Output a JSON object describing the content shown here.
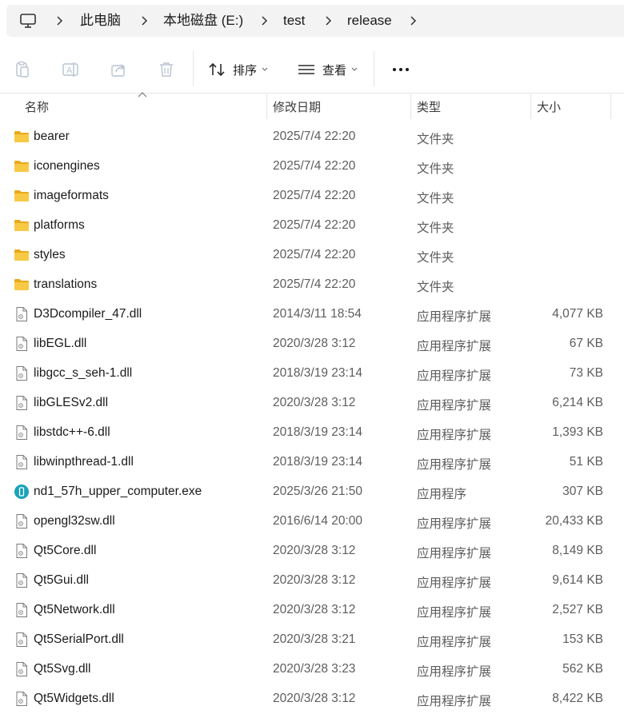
{
  "breadcrumb": [
    "此电脑",
    "本地磁盘 (E:)",
    "test",
    "release"
  ],
  "toolbar": {
    "sort_label": "排序",
    "view_label": "查看"
  },
  "columns": {
    "name": "名称",
    "date": "修改日期",
    "type": "类型",
    "size": "大小"
  },
  "files": [
    {
      "icon": "folder",
      "name": "bearer",
      "date": "2025/7/4 22:20",
      "type": "文件夹",
      "size": ""
    },
    {
      "icon": "folder",
      "name": "iconengines",
      "date": "2025/7/4 22:20",
      "type": "文件夹",
      "size": ""
    },
    {
      "icon": "folder",
      "name": "imageformats",
      "date": "2025/7/4 22:20",
      "type": "文件夹",
      "size": ""
    },
    {
      "icon": "folder",
      "name": "platforms",
      "date": "2025/7/4 22:20",
      "type": "文件夹",
      "size": ""
    },
    {
      "icon": "folder",
      "name": "styles",
      "date": "2025/7/4 22:20",
      "type": "文件夹",
      "size": ""
    },
    {
      "icon": "folder",
      "name": "translations",
      "date": "2025/7/4 22:20",
      "type": "文件夹",
      "size": ""
    },
    {
      "icon": "dll",
      "name": "D3Dcompiler_47.dll",
      "date": "2014/3/11 18:54",
      "type": "应用程序扩展",
      "size": "4,077 KB"
    },
    {
      "icon": "dll",
      "name": "libEGL.dll",
      "date": "2020/3/28 3:12",
      "type": "应用程序扩展",
      "size": "67 KB"
    },
    {
      "icon": "dll",
      "name": "libgcc_s_seh-1.dll",
      "date": "2018/3/19 23:14",
      "type": "应用程序扩展",
      "size": "73 KB"
    },
    {
      "icon": "dll",
      "name": "libGLESv2.dll",
      "date": "2020/3/28 3:12",
      "type": "应用程序扩展",
      "size": "6,214 KB"
    },
    {
      "icon": "dll",
      "name": "libstdc++-6.dll",
      "date": "2018/3/19 23:14",
      "type": "应用程序扩展",
      "size": "1,393 KB"
    },
    {
      "icon": "dll",
      "name": "libwinpthread-1.dll",
      "date": "2018/3/19 23:14",
      "type": "应用程序扩展",
      "size": "51 KB"
    },
    {
      "icon": "exe",
      "name": "nd1_57h_upper_computer.exe",
      "date": "2025/3/26 21:50",
      "type": "应用程序",
      "size": "307 KB"
    },
    {
      "icon": "dll",
      "name": "opengl32sw.dll",
      "date": "2016/6/14 20:00",
      "type": "应用程序扩展",
      "size": "20,433 KB"
    },
    {
      "icon": "dll",
      "name": "Qt5Core.dll",
      "date": "2020/3/28 3:12",
      "type": "应用程序扩展",
      "size": "8,149 KB"
    },
    {
      "icon": "dll",
      "name": "Qt5Gui.dll",
      "date": "2020/3/28 3:12",
      "type": "应用程序扩展",
      "size": "9,614 KB"
    },
    {
      "icon": "dll",
      "name": "Qt5Network.dll",
      "date": "2020/3/28 3:12",
      "type": "应用程序扩展",
      "size": "2,527 KB"
    },
    {
      "icon": "dll",
      "name": "Qt5SerialPort.dll",
      "date": "2020/3/28 3:21",
      "type": "应用程序扩展",
      "size": "153 KB"
    },
    {
      "icon": "dll",
      "name": "Qt5Svg.dll",
      "date": "2020/3/28 3:23",
      "type": "应用程序扩展",
      "size": "562 KB"
    },
    {
      "icon": "dll",
      "name": "Qt5Widgets.dll",
      "date": "2020/3/28 3:12",
      "type": "应用程序扩展",
      "size": "8,422 KB"
    }
  ],
  "colors": {
    "folder": "#f8c945",
    "folder_dark": "#e8a91a",
    "exe_icon": "#1aa3b8"
  }
}
